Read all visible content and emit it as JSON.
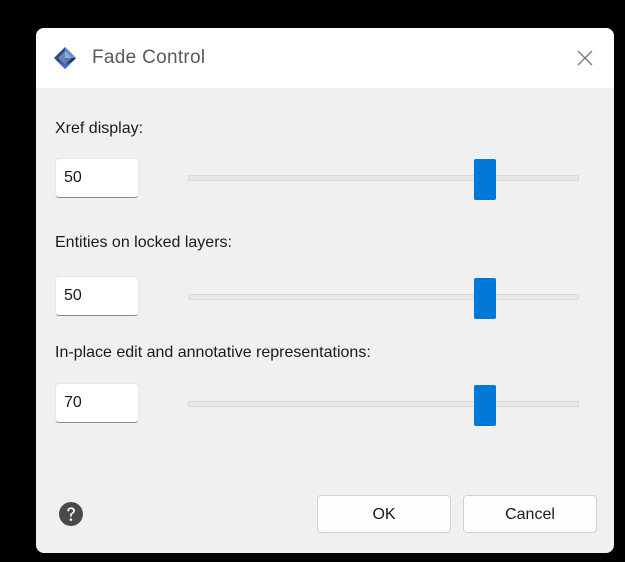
{
  "dialog": {
    "title": "Fade Control",
    "app_icon": "autocad-logo-icon",
    "close_icon": "close-icon"
  },
  "settings": [
    {
      "label": "Xref display:",
      "value": "50",
      "slider_fraction": 0.76
    },
    {
      "label": "Entities on locked layers:",
      "value": "50",
      "slider_fraction": 0.76
    },
    {
      "label": "In-place edit and annotative representations:",
      "value": "70",
      "slider_fraction": 0.76
    }
  ],
  "footer": {
    "help_icon": "help-icon",
    "ok_label": "OK",
    "cancel_label": "Cancel"
  },
  "colors": {
    "accent": "#0078d7",
    "dialog_bg": "#f0f0f0",
    "titlebar_bg": "#ffffff"
  }
}
